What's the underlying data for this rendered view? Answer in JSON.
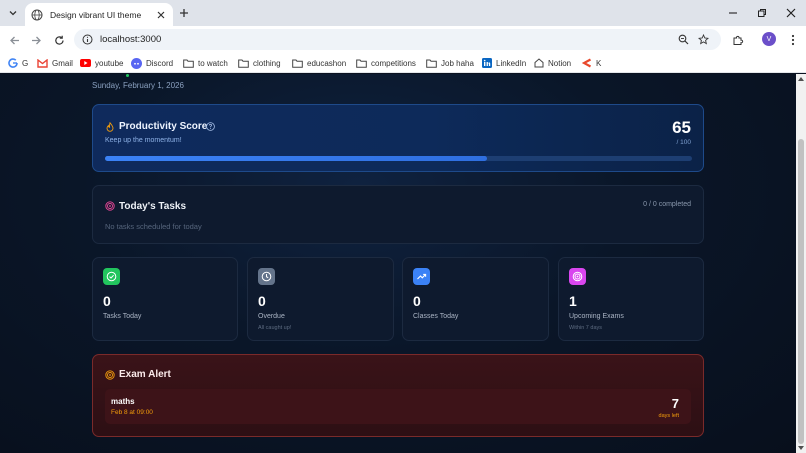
{
  "browser": {
    "tab_title": "Design vibrant UI theme",
    "url": "localhost:3000",
    "profile_initial": "V",
    "bookmarks": [
      {
        "label": "G",
        "icon": "google-icon"
      },
      {
        "label": "Gmail",
        "icon": "gmail-icon"
      },
      {
        "label": "youtube",
        "icon": "youtube-icon"
      },
      {
        "label": "Discord",
        "icon": "discord-icon"
      },
      {
        "label": "to watch",
        "icon": "folder-icon"
      },
      {
        "label": "clothing",
        "icon": "folder-icon"
      },
      {
        "label": "educashon",
        "icon": "folder-icon"
      },
      {
        "label": "competitions",
        "icon": "folder-icon"
      },
      {
        "label": "Job haha",
        "icon": "folder-icon"
      },
      {
        "label": "LinkedIn",
        "icon": "linkedin-icon"
      },
      {
        "label": "Notion",
        "icon": "notion-icon"
      },
      {
        "label": "K",
        "icon": "k-icon"
      }
    ]
  },
  "page": {
    "date": "Sunday, February 1, 2026",
    "productivity": {
      "title": "Productivity Score",
      "subtitle": "Keep up the momentum!",
      "score": "65",
      "max": "/ 100",
      "progress_fraction": 0.65
    },
    "tasks": {
      "title": "Today's Tasks",
      "count": "0 / 0 completed",
      "empty": "No tasks scheduled for today"
    },
    "stats": [
      {
        "value": "0",
        "label": "Tasks Today",
        "sub": "",
        "icon": "check-circle-icon",
        "color": "#22c55e"
      },
      {
        "value": "0",
        "label": "Overdue",
        "sub": "All caught up!",
        "icon": "clock-icon",
        "color": "#64748b"
      },
      {
        "value": "0",
        "label": "Classes Today",
        "sub": "",
        "icon": "trending-up-icon",
        "color": "#3b82f6"
      },
      {
        "value": "1",
        "label": "Upcoming Exams",
        "sub": "Within 7 days",
        "icon": "target-icon",
        "color": "#d946ef"
      }
    ],
    "exam_alert": {
      "title": "Exam Alert",
      "subject": "maths",
      "date": "Feb 8 at 09:00",
      "days": "7",
      "days_label": "days left"
    }
  },
  "colors": {
    "accent_blue": "#3b82f6",
    "exam_accent": "#f59e0b",
    "background": "#0a1628"
  }
}
